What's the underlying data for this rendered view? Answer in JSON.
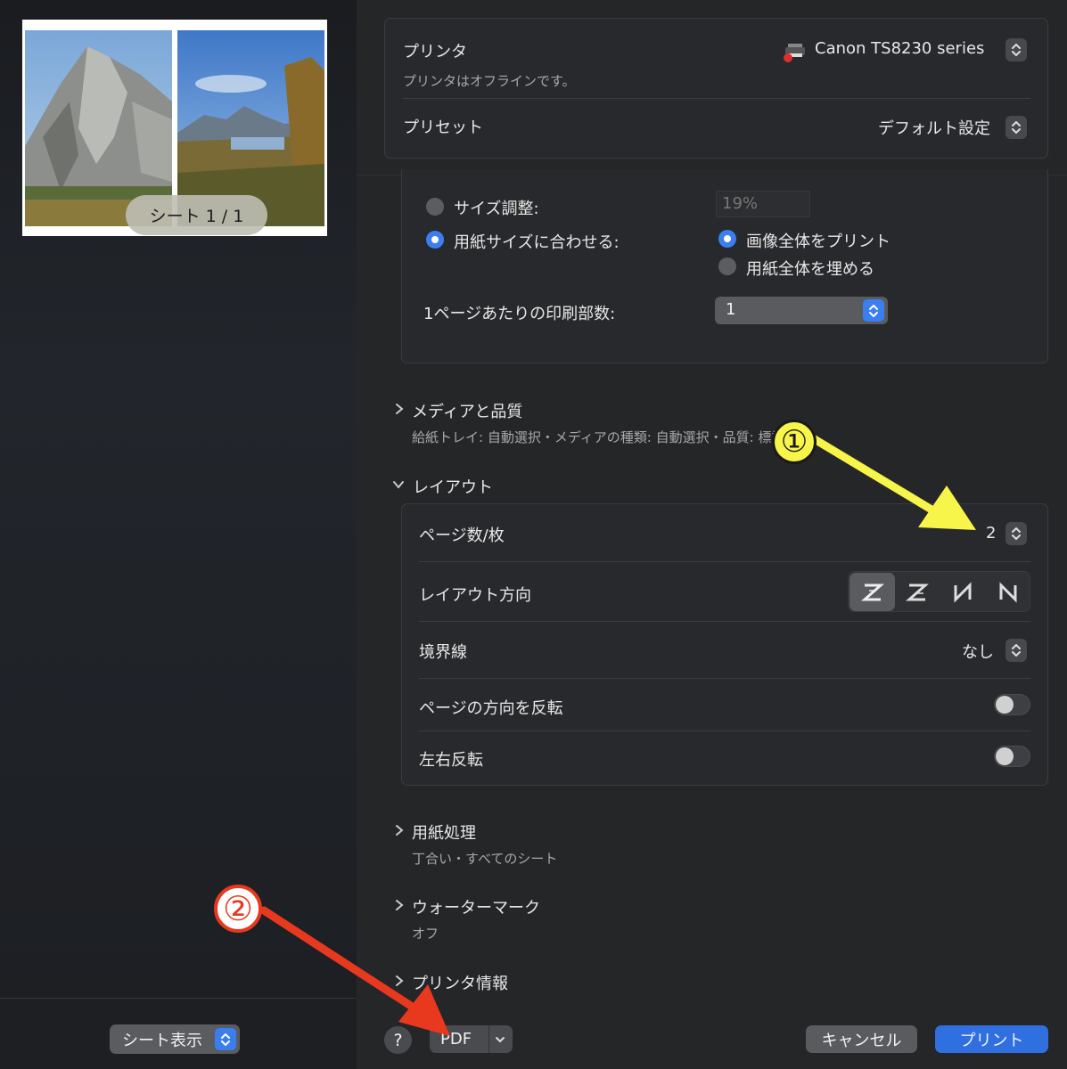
{
  "preview": {
    "sheet_label": "シート 1 / 1"
  },
  "sheet_view": {
    "label": "シート表示"
  },
  "printer": {
    "label": "プリンタ",
    "value": "Canon TS8230 series",
    "status": "プリンタはオフラインです。"
  },
  "preset": {
    "label": "プリセット",
    "value": "デフォルト設定"
  },
  "scaling": {
    "size_adjust_label": "サイズ調整:",
    "size_adjust_value": "19%",
    "fit_paper_label": "用紙サイズに合わせる:",
    "print_whole_label": "画像全体をプリント",
    "fill_paper_label": "用紙全体を埋める",
    "copies_per_page_label": "1ページあたりの印刷部数:",
    "copies_per_page_value": "1"
  },
  "sections": {
    "media": {
      "title": "メディアと品質",
      "summary": "給紙トレイ: 自動選択・メディアの種類: 自動選択・品質: 標準"
    },
    "layout": {
      "title": "レイアウト",
      "pages_per_sheet_label": "ページ数/枚",
      "pages_per_sheet_value": "2",
      "direction_label": "レイアウト方向",
      "border_label": "境界線",
      "border_value": "なし",
      "reverse_orientation_label": "ページの方向を反転",
      "flip_horizontal_label": "左右反転"
    },
    "paper_handling": {
      "title": "用紙処理",
      "summary": "丁合い・すべてのシート"
    },
    "watermark": {
      "title": "ウォーターマーク",
      "summary": "オフ"
    },
    "printer_info": {
      "title": "プリンタ情報"
    }
  },
  "footer": {
    "help": "?",
    "pdf": "PDF",
    "cancel": "キャンセル",
    "print": "プリント"
  },
  "annotations": {
    "marker1": "①",
    "marker2": "②"
  },
  "colors": {
    "accent": "#3b7ef0",
    "annotation_yellow": "#f7f44a",
    "annotation_red": "#e8391f"
  }
}
